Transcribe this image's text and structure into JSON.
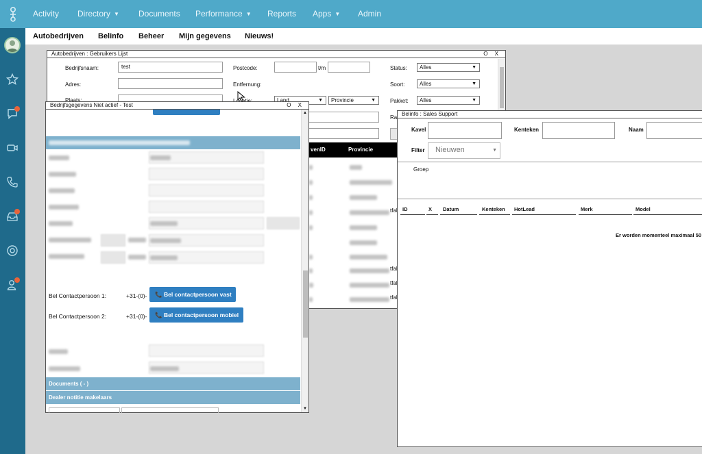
{
  "topnav": {
    "items": [
      {
        "label": "Activity",
        "has_caret": false
      },
      {
        "label": "Directory",
        "has_caret": true
      },
      {
        "label": "Documents",
        "has_caret": false
      },
      {
        "label": "Performance",
        "has_caret": true
      },
      {
        "label": "Reports",
        "has_caret": false
      },
      {
        "label": "Apps",
        "has_caret": true
      },
      {
        "label": "Admin",
        "has_caret": false
      }
    ],
    "caret": "▼"
  },
  "sidebar": {
    "icons": [
      "avatar",
      "star-icon",
      "chat-icon",
      "video-icon",
      "phone-icon",
      "inbox-icon",
      "lifebuoy-icon",
      "user-alert-icon"
    ],
    "badge_color": "#e8643a"
  },
  "submenu": {
    "items": [
      "Autobedrijven",
      "Belinfo",
      "Beheer",
      "Mijn gegevens",
      "Nieuws!"
    ]
  },
  "win_users": {
    "title": "Autobedrijven : Gebruikers Lijst",
    "controls": "O X",
    "bedrijfsnaam_label": "Bedrijfsnaam:",
    "bedrijfsnaam_value": "test",
    "adres_label": "Adres:",
    "plaats_label": "Plaats:",
    "postcode_label": "Postcode:",
    "tm_label": "t/m",
    "entfernung_label": "Entfernung:",
    "locatie_label": "Locatie:",
    "land_value": "Land",
    "provincie_value": "Provincie",
    "status_label": "Status:",
    "status_value": "Alles",
    "soort_label": "Soort:",
    "soort_value": "Alles",
    "pakket_label": "Pakket:",
    "pakket_value": "Alles",
    "ra_label": "Ra",
    "col_id": "venID",
    "col_provincie": "Provincie",
    "row_suffix": "tfak"
  },
  "win_bedrijf": {
    "title": "Bedrijfsgegevens Niet actief - Test",
    "controls": "O X",
    "bel1_label": "Bel Contactpersoon 1:",
    "bel1_prefix": "+31-(0)-",
    "bel1_button": "Bel contactpersoon vast",
    "bel2_label": "Bel Contactpersoon 2:",
    "bel2_prefix": "+31-(0)-",
    "bel2_button": "Bel contactpersoon mobiel",
    "documents_bar": "Documents ( - )",
    "dealer_bar": "Dealer notitie makelaars"
  },
  "win_sales": {
    "title": "Belinfo : Sales Support",
    "kavel_label": "Kavel",
    "kenteken_label": "Kenteken",
    "naam_label": "Naam",
    "filter_label": "Filter",
    "filter_value": "Nieuwen",
    "groep_label": "Groep",
    "columns": [
      "ID",
      "X",
      "Datum",
      "Kenteken",
      "HotLead",
      "Merk",
      "Model"
    ],
    "notice": "Er worden momenteel maximaal 50"
  }
}
